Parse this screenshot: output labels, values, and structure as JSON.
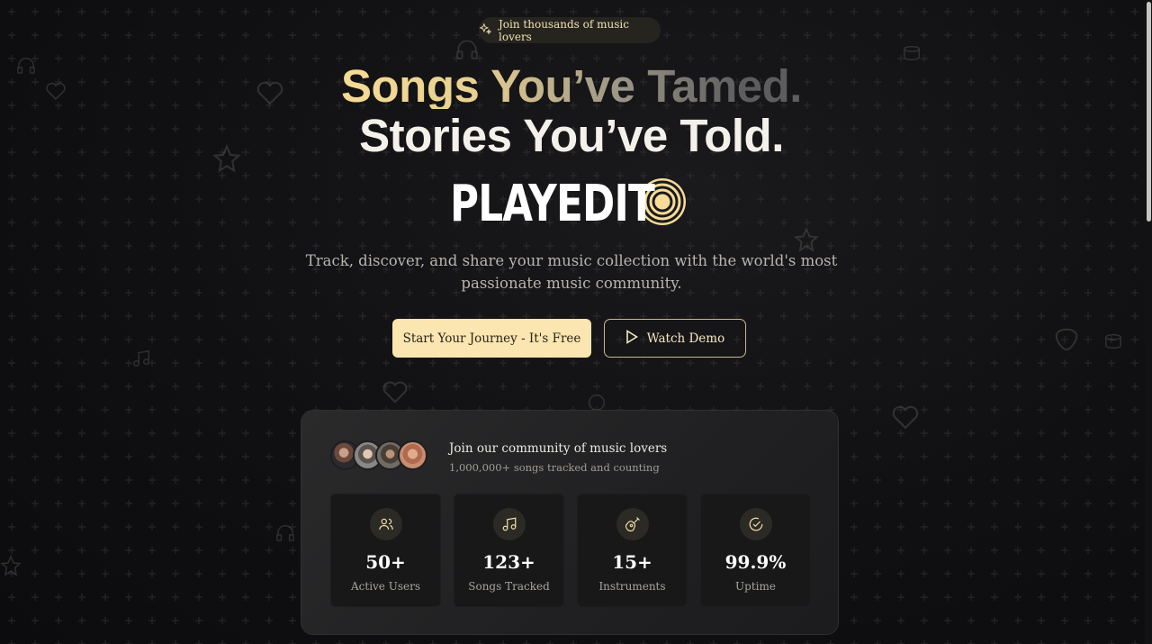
{
  "badge": {
    "label": "Join thousands of music lovers",
    "icon": "sparkles-icon"
  },
  "hero": {
    "line1": "Songs You’ve Tamed.",
    "line2": "Stories You’ve Told.",
    "brand": "PLAYEDIT",
    "brand_icon": "vinyl-record-icon",
    "description": "Track, discover, and share your music collection with the world's most passionate music community."
  },
  "actions": {
    "primary": "Start Your Journey - It's Free",
    "secondary": "Watch Demo",
    "secondary_icon": "play-icon"
  },
  "community": {
    "title": "Join our community of music lovers",
    "subtitle": "1,000,000+ songs tracked and counting",
    "stats": [
      {
        "icon": "users-icon",
        "value": "50+",
        "label": "Active Users"
      },
      {
        "icon": "music-note-icon",
        "value": "123+",
        "label": "Songs Tracked"
      },
      {
        "icon": "guitar-icon",
        "value": "15+",
        "label": "Instruments"
      },
      {
        "icon": "check-circle-icon",
        "value": "99.9%",
        "label": "Uptime"
      }
    ]
  },
  "colors": {
    "background": "#101012",
    "accent": "#fbe5b0",
    "gold": "#f2dfa9"
  }
}
